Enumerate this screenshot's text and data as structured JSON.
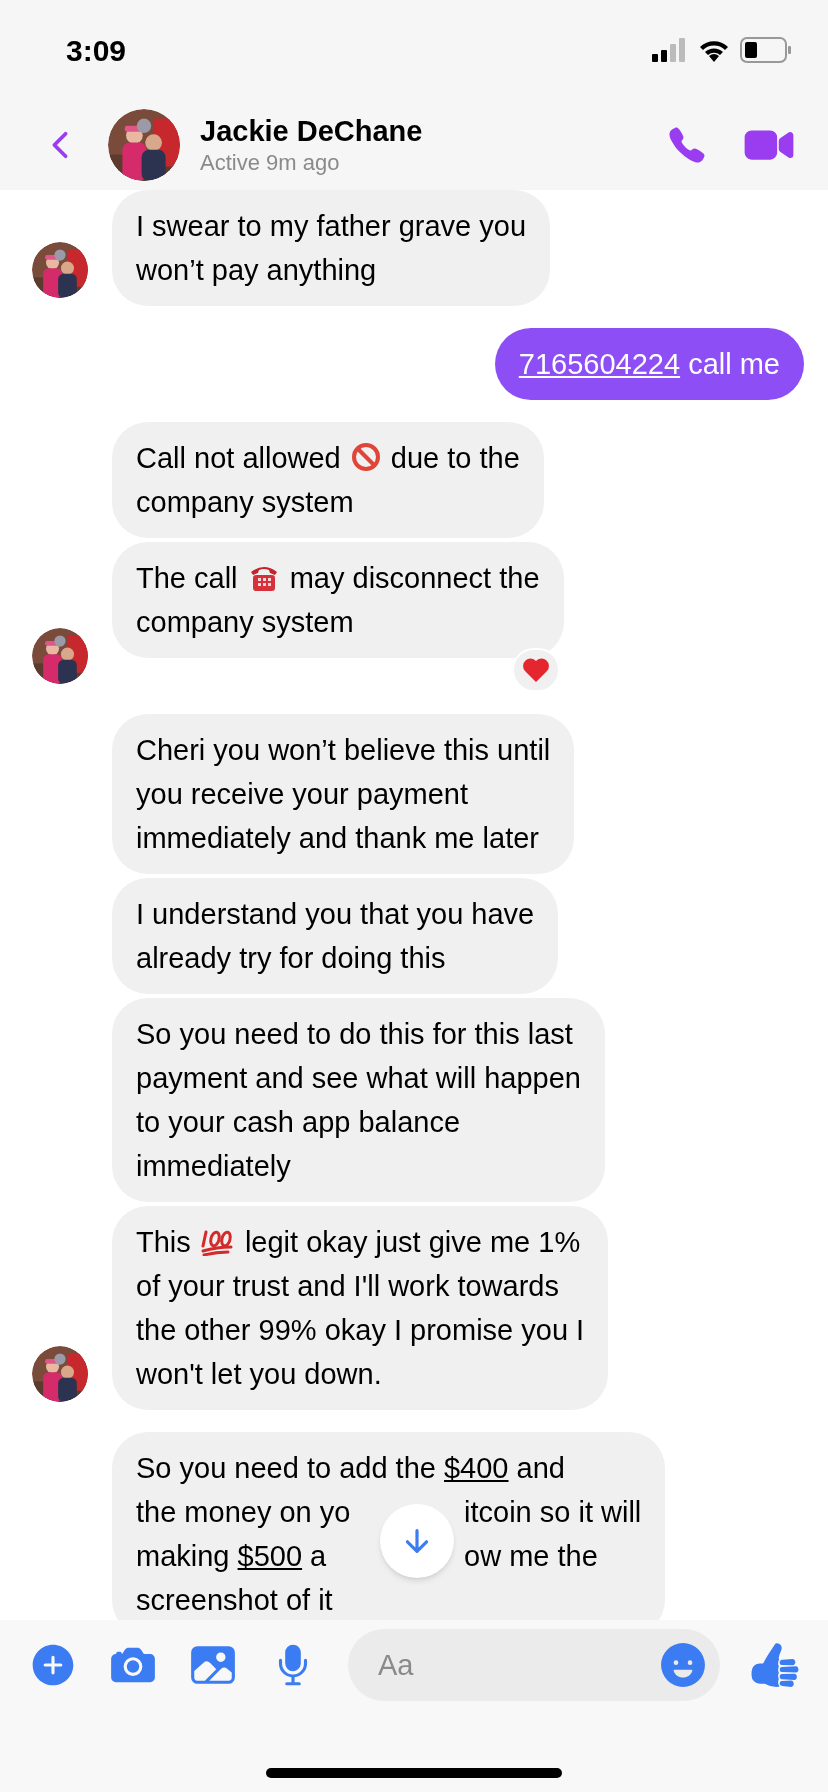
{
  "status_bar": {
    "time": "3:09"
  },
  "header": {
    "name": "Jackie DeChane",
    "status": "Active 9m ago"
  },
  "groups": [
    {
      "outgoing": false,
      "show_avatar": true,
      "bubbles": [
        {
          "lines": [
            [
              {
                "kind": "text",
                "text": "I swear to my father grave you"
              }
            ],
            [
              {
                "kind": "text",
                "text": "won’t pay anything"
              }
            ]
          ]
        }
      ]
    },
    {
      "outgoing": true,
      "show_avatar": false,
      "bubbles": [
        {
          "lines": [
            [
              {
                "kind": "link",
                "text": "7165604224"
              },
              {
                "kind": "text",
                "text": " call me"
              }
            ]
          ]
        }
      ]
    },
    {
      "outgoing": false,
      "show_avatar": true,
      "bubbles": [
        {
          "lines": [
            [
              {
                "kind": "text",
                "text": "Call not allowed "
              },
              {
                "kind": "prohibited"
              },
              {
                "kind": "text",
                "text": " due to the"
              }
            ],
            [
              {
                "kind": "text",
                "text": "company system"
              }
            ]
          ]
        },
        {
          "lines": [
            [
              {
                "kind": "text",
                "text": "The call "
              },
              {
                "kind": "telephone"
              },
              {
                "kind": "text",
                "text": " may disconnect the"
              }
            ],
            [
              {
                "kind": "text",
                "text": "company system"
              }
            ]
          ],
          "heart_reaction": true
        }
      ]
    },
    {
      "outgoing": false,
      "show_avatar": true,
      "bubbles": [
        {
          "lines": [
            [
              {
                "kind": "text",
                "text": "Cheri you won’t believe this until"
              }
            ],
            [
              {
                "kind": "text",
                "text": "you receive your payment"
              }
            ],
            [
              {
                "kind": "text",
                "text": "immediately and thank me later"
              }
            ]
          ]
        },
        {
          "lines": [
            [
              {
                "kind": "text",
                "text": "I understand you that you have"
              }
            ],
            [
              {
                "kind": "text",
                "text": "already try for doing this"
              }
            ]
          ]
        },
        {
          "lines": [
            [
              {
                "kind": "text",
                "text": "So you need to do this for this last"
              }
            ],
            [
              {
                "kind": "text",
                "text": "payment and see what will happen"
              }
            ],
            [
              {
                "kind": "text",
                "text": "to your cash app balance"
              }
            ],
            [
              {
                "kind": "text",
                "text": "immediately"
              }
            ]
          ]
        },
        {
          "lines": [
            [
              {
                "kind": "text",
                "text": "This "
              },
              {
                "kind": "hundred"
              },
              {
                "kind": "text",
                "text": " legit okay just give me 1%"
              }
            ],
            [
              {
                "kind": "text",
                "text": "of your trust and I'll work towards"
              }
            ],
            [
              {
                "kind": "text",
                "text": "the other 99% okay I promise you I"
              }
            ],
            [
              {
                "kind": "text",
                "text": "won't let you down."
              }
            ]
          ]
        }
      ]
    },
    {
      "outgoing": false,
      "show_avatar": false,
      "bubbles": [
        {
          "lines": [
            [
              {
                "kind": "text",
                "text": "So you need to add the "
              },
              {
                "kind": "link",
                "text": "$400"
              },
              {
                "kind": "text",
                "text": " and"
              }
            ],
            [
              {
                "kind": "text",
                "text": "the money on yo"
              },
              {
                "kind": "gap"
              },
              {
                "kind": "text",
                "text": "itcoin so it will"
              }
            ],
            [
              {
                "kind": "text",
                "text": "making "
              },
              {
                "kind": "link",
                "text": "$500"
              },
              {
                "kind": "text",
                "text": " a"
              },
              {
                "kind": "scroll_button"
              },
              {
                "kind": "text",
                "text": "ow me the"
              }
            ],
            [
              {
                "kind": "text",
                "text": "screenshot of it"
              }
            ]
          ]
        }
      ]
    }
  ],
  "composer": {
    "placeholder": "Aa"
  }
}
